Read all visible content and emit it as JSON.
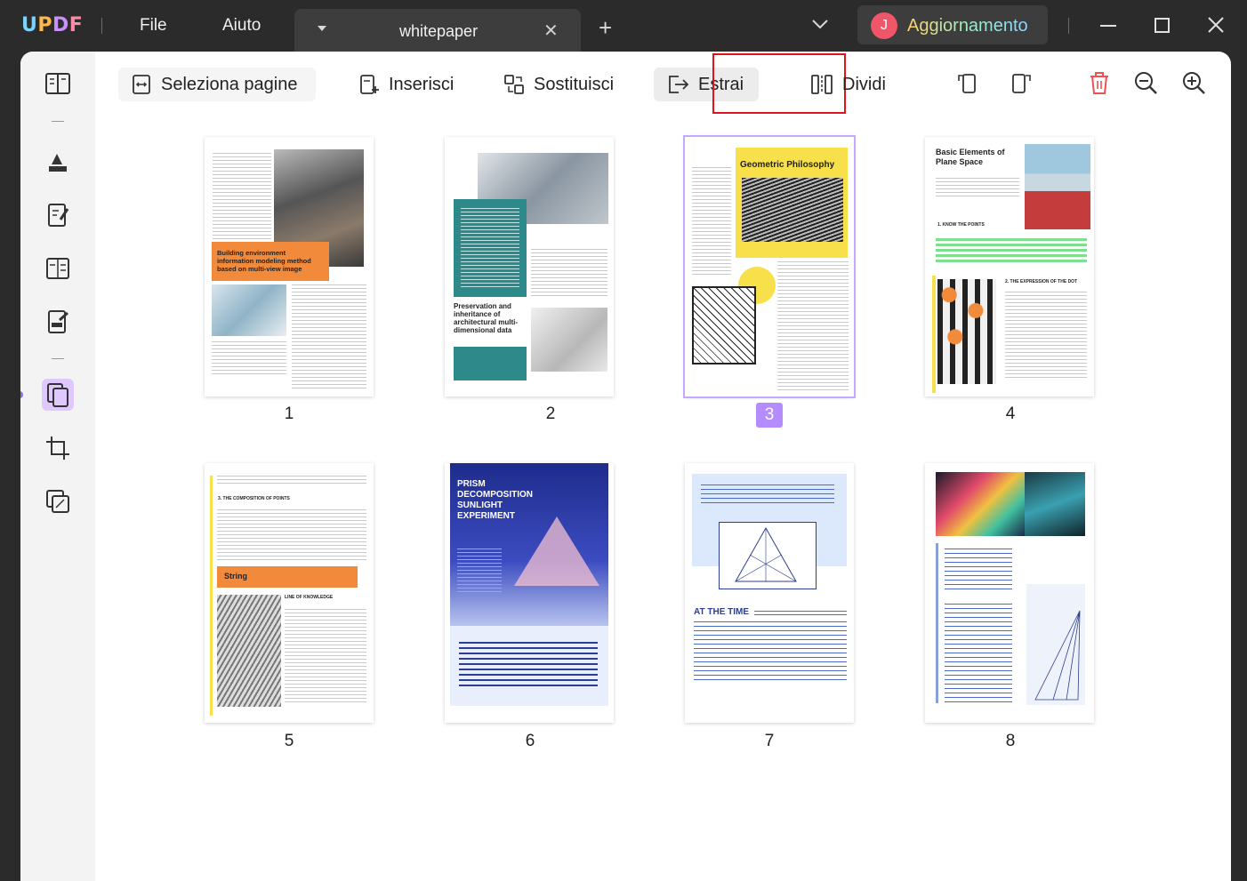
{
  "app": {
    "logo": "UPDF",
    "menu": [
      "File",
      "Aiuto"
    ],
    "tab_title": "whitepaper",
    "avatar_letter": "J",
    "upgrade_label": "Aggiornamento"
  },
  "toolbar": {
    "select_pages": "Seleziona pagine",
    "insert": "Inserisci",
    "replace": "Sostituisci",
    "extract": "Estrai",
    "split": "Dividi"
  },
  "colors": {
    "accent": "#b48cff",
    "highlight_border": "#e0141e",
    "orange": "#f28a3b",
    "navy": "#2c3e8f"
  },
  "pages": [
    {
      "number": "1",
      "headline": "Building environment information modeling method based on multi-view image"
    },
    {
      "number": "2",
      "headline": "Preservation and inheritance of architectural multi-dimensional data"
    },
    {
      "number": "3",
      "headline": "Geometric Philosophy",
      "selected": true
    },
    {
      "number": "4",
      "headline": "Basic Elements of Plane Space",
      "sub1": "1. KNOW THE POINTS",
      "sub2": "2. THE EXPRESSION OF THE DOT"
    },
    {
      "number": "5",
      "headline": "String",
      "sub1": "3. THE COMPOSITION OF POINTS",
      "sub2": "LINE OF KNOWLEDGE"
    },
    {
      "number": "6",
      "headline": "PRISM DECOMPOSITION SUNLIGHT EXPERIMENT"
    },
    {
      "number": "7",
      "headline": "AT THE TIME"
    },
    {
      "number": "8",
      "headline": ""
    }
  ]
}
